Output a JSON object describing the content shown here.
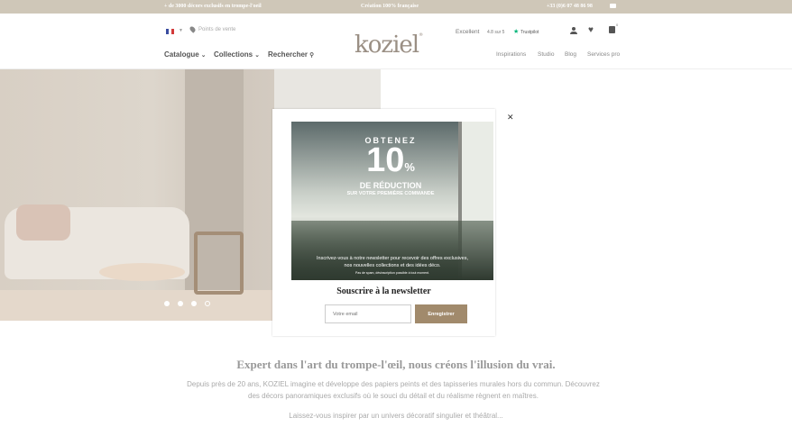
{
  "topbar": {
    "left": "+ de 3000 décors exclusifs en trompe-l'oeil",
    "center": "Création 100% française",
    "phone": "+33 (0)6 07 48 86 98"
  },
  "header": {
    "stores": "Points de vente",
    "logo": "koziel",
    "rating_label": "Excellent",
    "rating_value": "4.8 sur 5",
    "trustpilot": "Trustpilot",
    "cart_count": "0",
    "nav_left": [
      "Catalogue",
      "Collections",
      "Rechercher"
    ],
    "nav_right": [
      "Inspirations",
      "Studio",
      "Blog",
      "Services pro"
    ]
  },
  "hero": {
    "slides_total": 4,
    "active_slide": 1
  },
  "modal": {
    "promo": {
      "line1": "OBTENEZ",
      "percent": "10",
      "percent_sign": "%",
      "line2": "DE RÉDUCTION",
      "line3": "SUR VOTRE PREMIÈRE COMMANDE",
      "body1": "Inscrivez-vous à notre newsletter pour recevoir des offres exclusives,",
      "body2": "nos nouvelles collections et des idées déco.",
      "fine": "Pas de spam, désinscription possible à tout moment."
    },
    "title": "Souscrire à la newsletter",
    "email_placeholder": "Votre email",
    "submit_label": "Enregistrer"
  },
  "main": {
    "headline": "Expert dans l'art du trompe-l'œil, nous créons l'illusion du vrai.",
    "paragraph": "Depuis près de 20 ans, KOZIEL imagine et développe des papiers peints et des tapisseries murales hors du commun. Découvrez des décors panoramiques exclusifs où le souci du détail et du réalisme règnent en maîtres.",
    "paragraph2": "Laissez-vous inspirer par un univers décoratif singulier et théâtral..."
  },
  "colors": {
    "topbar": "#cfc7b8",
    "accent": "#a18a6c",
    "logo": "#9a8f84"
  }
}
